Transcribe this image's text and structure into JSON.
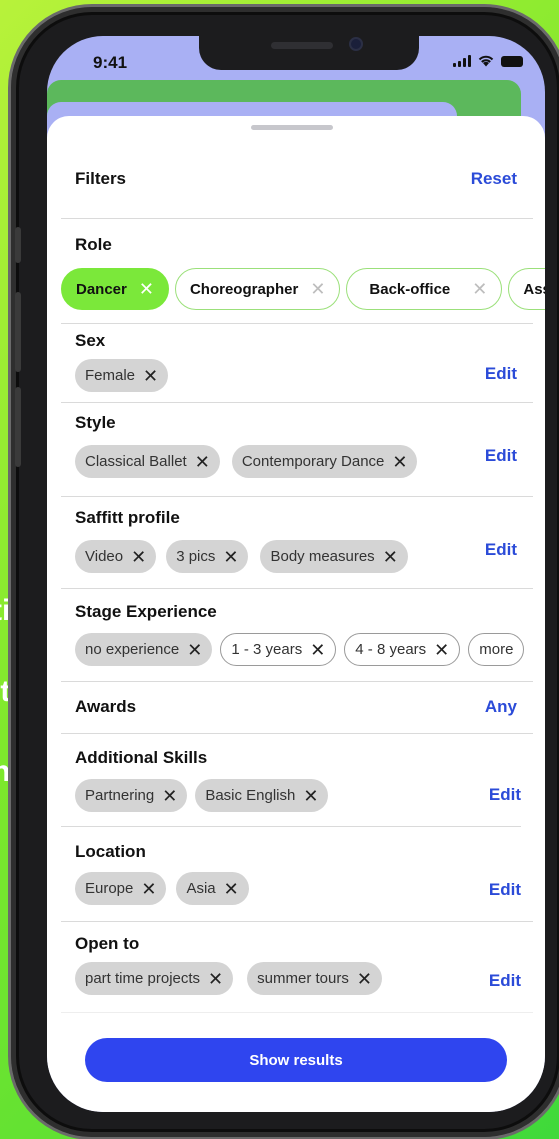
{
  "background": {
    "text_1": "ti",
    "text_2": "ıt",
    "text_3": "n"
  },
  "status_bar": {
    "time": "9:41"
  },
  "header": {
    "title": "Filters",
    "reset": "Reset"
  },
  "role": {
    "title": "Role",
    "chips": [
      {
        "label": "Dancer",
        "active": true
      },
      {
        "label": "Choreographer",
        "active": false
      },
      {
        "label": "Back-office",
        "active": false
      },
      {
        "label": "Ass",
        "active": false
      }
    ]
  },
  "sex": {
    "title": "Sex",
    "edit": "Edit",
    "chips": [
      "Female"
    ]
  },
  "style": {
    "title": "Style",
    "edit": "Edit",
    "chips": [
      "Classical Ballet",
      "Contemporary Dance"
    ]
  },
  "saffitt_profile": {
    "title": "Saffitt profile",
    "edit": "Edit",
    "chips": [
      "Video",
      "3 pics",
      "Body measures"
    ]
  },
  "stage_experience": {
    "title": "Stage Experience",
    "chips": [
      "no experience",
      "1 - 3 years",
      "4 - 8 years",
      "more"
    ]
  },
  "awards": {
    "title": "Awards",
    "value": "Any"
  },
  "additional_skills": {
    "title": "Additional Skills",
    "edit": "Edit",
    "chips": [
      "Partnering",
      "Basic English"
    ]
  },
  "location": {
    "title": "Location",
    "edit": "Edit",
    "chips": [
      "Europe",
      "Asia"
    ]
  },
  "open_to": {
    "title": "Open to",
    "edit": "Edit",
    "chips": [
      "part time projects",
      "summer tours"
    ]
  },
  "cta": {
    "label": "Show results"
  },
  "colors": {
    "accent": "#2f45ef",
    "link": "#2b4bd8",
    "active_chip": "#7be83a"
  }
}
